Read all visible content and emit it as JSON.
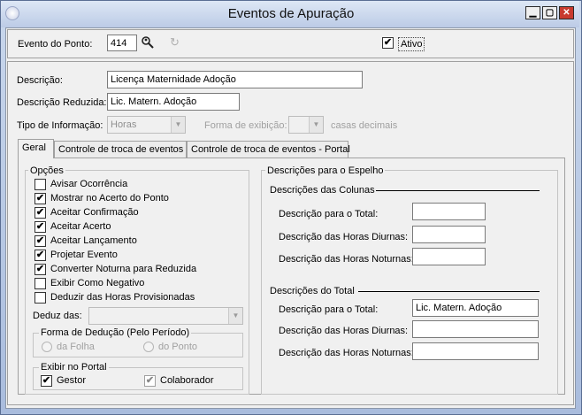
{
  "window": {
    "title": "Eventos de Apuração"
  },
  "header": {
    "evento_label": "Evento do Ponto:",
    "evento_value": "414",
    "ativo_label": "Ativo",
    "ativo_checked": "✔"
  },
  "form": {
    "descricao_label": "Descrição:",
    "descricao_value": "Licença Maternidade Adoção",
    "descricao_reduzida_label": "Descrição Reduzida:",
    "descricao_reduzida_value": "Lic. Matern. Adoção",
    "tipo_info_label": "Tipo de Informação:",
    "tipo_info_value": "Horas",
    "forma_exibicao_label": "Forma de exibição:",
    "forma_exibicao_value": "",
    "casas_decimais_label": "casas decimais"
  },
  "tabs": [
    {
      "label": "Geral"
    },
    {
      "label": "Controle de troca de eventos"
    },
    {
      "label": "Controle de troca de eventos - Portal"
    }
  ],
  "opcoes": {
    "title": "Opções",
    "items": [
      {
        "label": "Avisar Ocorrência",
        "mark": ""
      },
      {
        "label": "Mostrar no Acerto do Ponto",
        "mark": "✔"
      },
      {
        "label": "Aceitar Confirmação",
        "mark": "✔"
      },
      {
        "label": "Aceitar Acerto",
        "mark": "✔"
      },
      {
        "label": "Aceitar Lançamento",
        "mark": "✔"
      },
      {
        "label": "Projetar Evento",
        "mark": "✔"
      },
      {
        "label": "Converter Noturna para Reduzida",
        "mark": "✔"
      },
      {
        "label": "Exibir Como Negativo",
        "mark": ""
      },
      {
        "label": "Deduzir das Horas Provisionadas",
        "mark": ""
      }
    ],
    "deduz_das_label": "Deduz das:",
    "deduz_das_value": "",
    "forma_deducao_title": "Forma de Dedução (Pelo Período)",
    "da_folha_label": "da Folha",
    "do_ponto_label": "do Ponto",
    "exibir_portal_title": "Exibir no Portal",
    "gestor_label": "Gestor",
    "gestor_mark": "✔",
    "colaborador_label": "Colaborador",
    "colaborador_mark": "✔"
  },
  "espelho": {
    "title": "Descrições para o Espelho",
    "colunas_title": "Descrições das Colunas",
    "colunas": [
      {
        "label": "Descrição para o Total:",
        "value": ""
      },
      {
        "label": "Descrição das Horas Diurnas:",
        "value": ""
      },
      {
        "label": "Descrição das Horas Noturnas:",
        "value": ""
      }
    ],
    "total_title": "Descrições do Total",
    "total": [
      {
        "label": "Descrição para o Total:",
        "value": "Lic. Matern. Adoção"
      },
      {
        "label": "Descrição das Horas Diurnas:",
        "value": ""
      },
      {
        "label": "Descrição das Horas Noturnas:",
        "value": ""
      }
    ]
  },
  "icons": [
    "app-icon",
    "minimize-icon",
    "maximize-icon",
    "close-icon",
    "search-person-icon",
    "refresh-icon",
    "chevron-down-icon"
  ]
}
